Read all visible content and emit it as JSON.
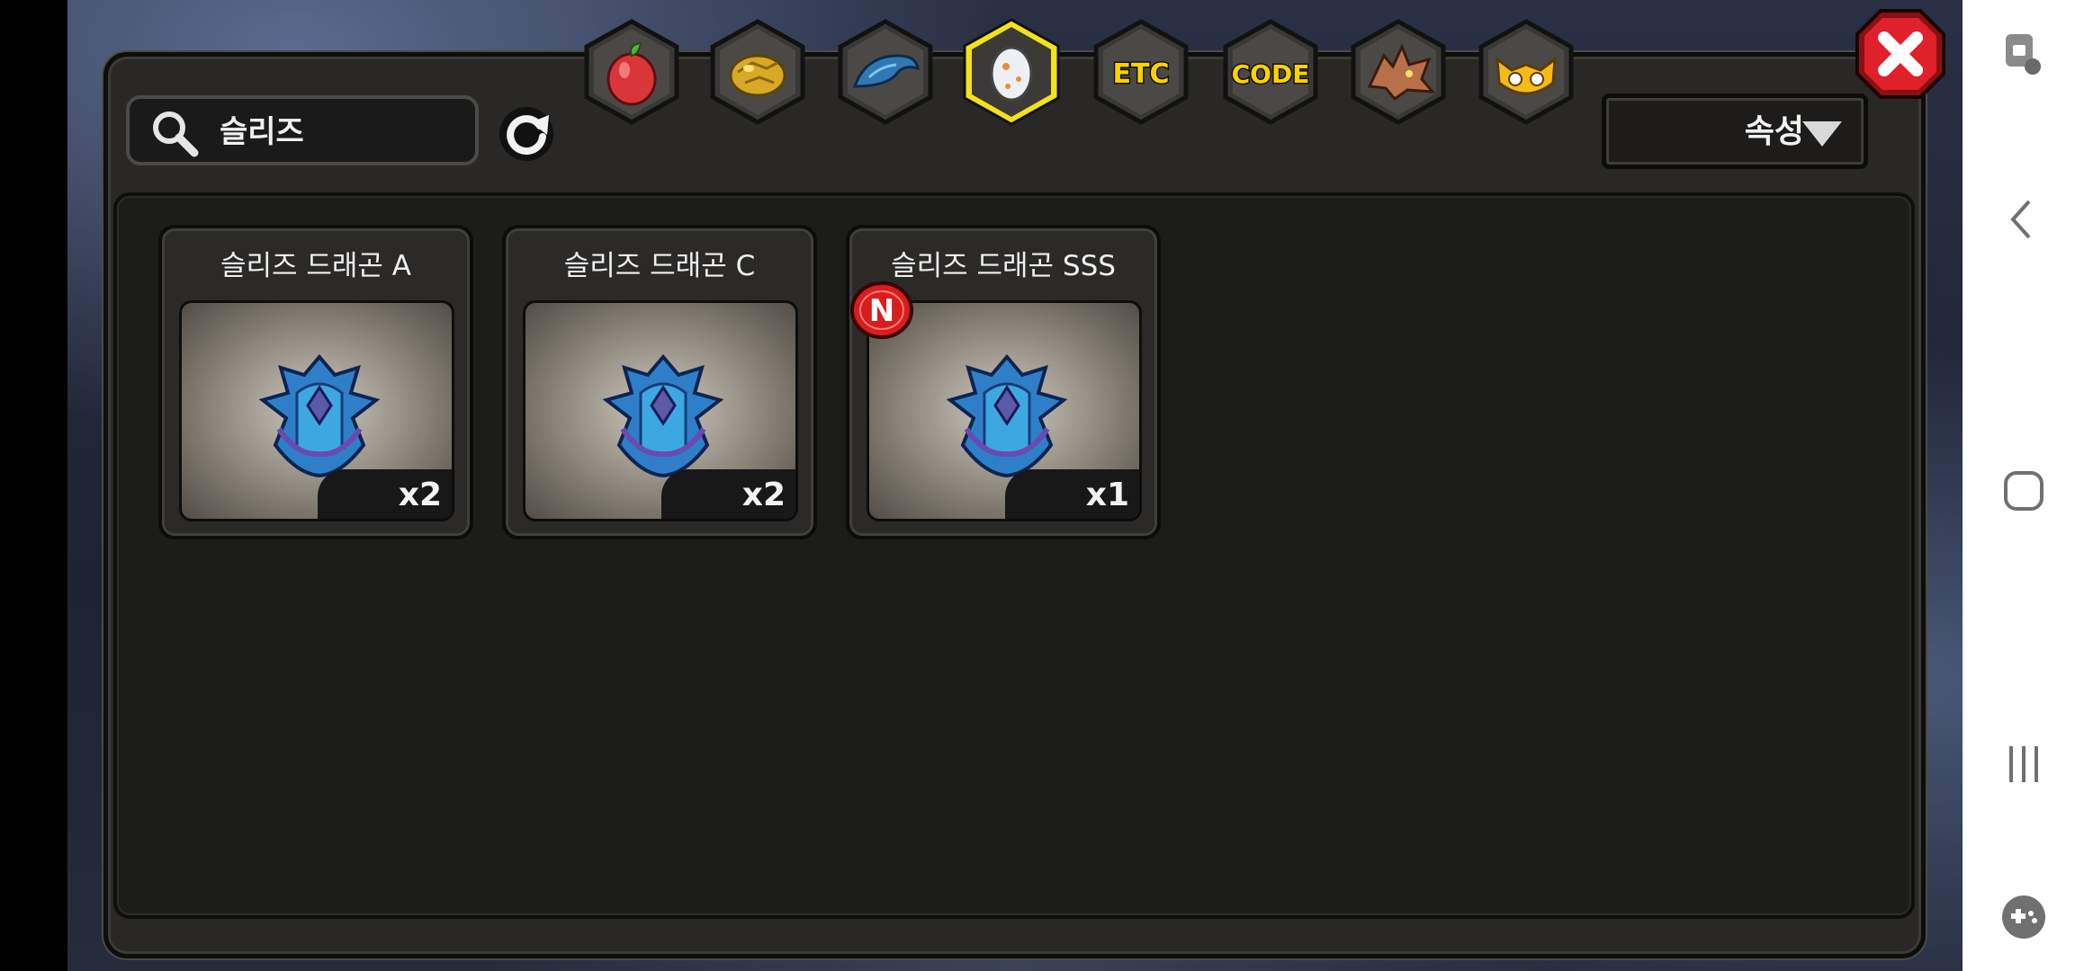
{
  "search": {
    "query": "슬리즈"
  },
  "filter": {
    "label": "속성"
  },
  "tabs": [
    {
      "name": "fruit",
      "icon": "red-fruit-icon",
      "selected": false
    },
    {
      "name": "gold",
      "icon": "gold-nugget-icon",
      "selected": false
    },
    {
      "name": "material",
      "icon": "blue-scale-icon",
      "selected": false
    },
    {
      "name": "egg",
      "icon": "egg-icon",
      "selected": true
    },
    {
      "name": "etc",
      "label": "ETC",
      "selected": false
    },
    {
      "name": "code",
      "label": "CODE",
      "selected": false
    },
    {
      "name": "dragon",
      "icon": "dragon-head-icon",
      "selected": false
    },
    {
      "name": "mask",
      "icon": "yellow-mask-icon",
      "selected": false
    }
  ],
  "items": [
    {
      "name": "슬리즈 드래곤 A",
      "count": "x2",
      "is_new": false
    },
    {
      "name": "슬리즈 드래곤 C",
      "count": "x2",
      "is_new": false
    },
    {
      "name": "슬리즈 드래곤 SSS",
      "count": "x1",
      "is_new": true
    }
  ],
  "new_badge_label": "N",
  "colors": {
    "panel_bg": "#292826",
    "content_bg": "#1c1c1b",
    "selected_tab_border": "#f2e21a",
    "tab_text": "#ffd200",
    "close_red": "#e0202a",
    "new_badge_red": "#d81d1d"
  }
}
